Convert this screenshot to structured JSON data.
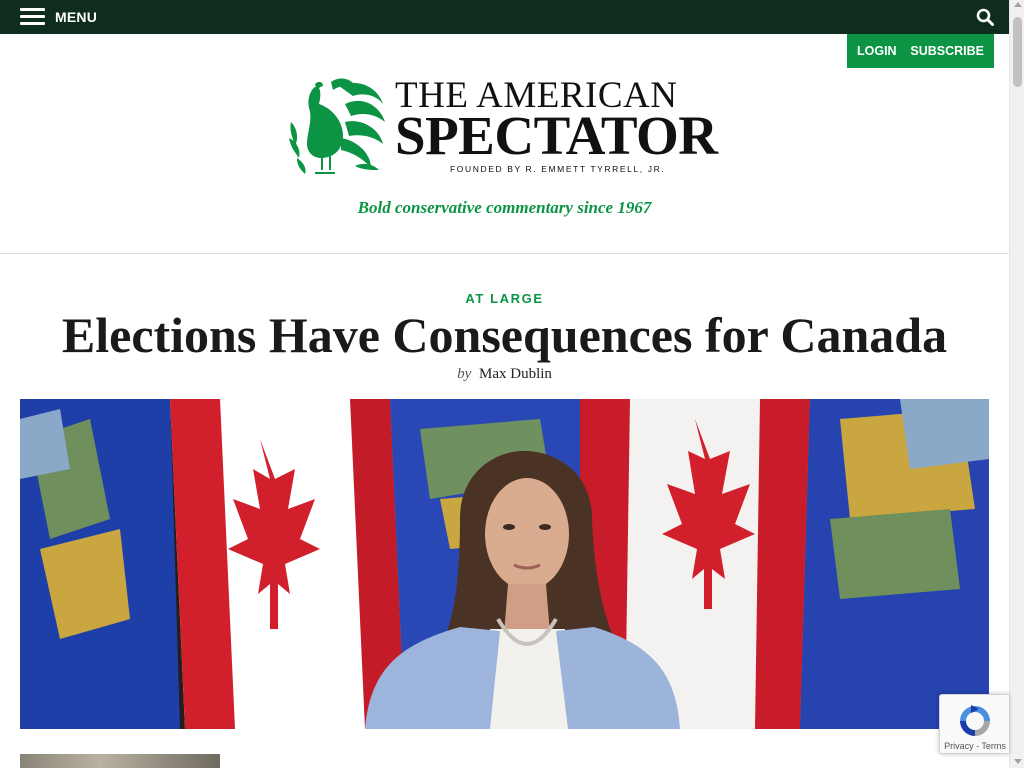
{
  "nav": {
    "menu_label": "MENU",
    "search_icon": "search-icon",
    "bg_color": "#0f2d1e"
  },
  "account": {
    "login_label": "LOGIN",
    "subscribe_label": "SUBSCRIBE",
    "bg_color": "#0c9444"
  },
  "masthead": {
    "logo_line1": "THE AMERICAN",
    "logo_line2": "SPECTATOR",
    "logo_line3": "FOUNDED BY R. EMMETT TYRRELL, JR.",
    "logo_icon": "turkey-logo-icon",
    "tagline": "Bold conservative commentary since 1967",
    "accent_color": "#0c9444"
  },
  "article": {
    "category": "AT LARGE",
    "title": "Elections Have Consequences for Canada",
    "byline_prefix": "by",
    "author": "Max Dublin",
    "hero_image": "woman-speaking-before-canada-and-alberta-flags"
  },
  "recaptcha": {
    "links": "Privacy - Terms",
    "icon": "recaptcha-icon"
  }
}
